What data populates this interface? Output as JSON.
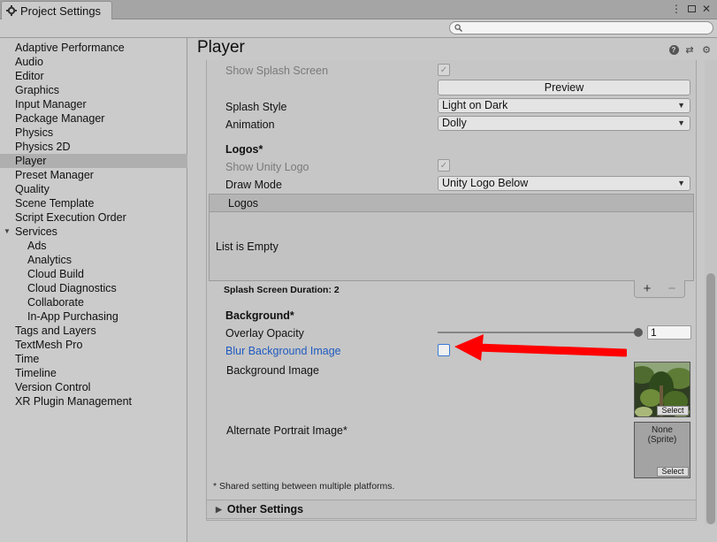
{
  "window": {
    "tab_title": "Project Settings",
    "colors": {
      "accent_blue": "#1f5bc0",
      "arrow_red": "#ff0000",
      "selected_row": "#afafaf"
    }
  },
  "search": {
    "placeholder": ""
  },
  "sidebar": {
    "items": [
      {
        "label": "Adaptive Performance",
        "indent": 0
      },
      {
        "label": "Audio",
        "indent": 0
      },
      {
        "label": "Editor",
        "indent": 0
      },
      {
        "label": "Graphics",
        "indent": 0
      },
      {
        "label": "Input Manager",
        "indent": 0
      },
      {
        "label": "Package Manager",
        "indent": 0
      },
      {
        "label": "Physics",
        "indent": 0
      },
      {
        "label": "Physics 2D",
        "indent": 0
      },
      {
        "label": "Player",
        "indent": 0,
        "selected": true
      },
      {
        "label": "Preset Manager",
        "indent": 0
      },
      {
        "label": "Quality",
        "indent": 0
      },
      {
        "label": "Scene Template",
        "indent": 0
      },
      {
        "label": "Script Execution Order",
        "indent": 0
      },
      {
        "label": "Services",
        "indent": 0,
        "expandable": true
      },
      {
        "label": "Ads",
        "indent": 1
      },
      {
        "label": "Analytics",
        "indent": 1
      },
      {
        "label": "Cloud Build",
        "indent": 1
      },
      {
        "label": "Cloud Diagnostics",
        "indent": 1
      },
      {
        "label": "Collaborate",
        "indent": 1
      },
      {
        "label": "In-App Purchasing",
        "indent": 1
      },
      {
        "label": "Tags and Layers",
        "indent": 0
      },
      {
        "label": "TextMesh Pro",
        "indent": 0
      },
      {
        "label": "Time",
        "indent": 0
      },
      {
        "label": "Timeline",
        "indent": 0
      },
      {
        "label": "Version Control",
        "indent": 0
      },
      {
        "label": "XR Plugin Management",
        "indent": 0
      }
    ]
  },
  "main": {
    "title": "Player",
    "splash": {
      "show_splash_label": "Show Splash Screen",
      "show_splash_checked": true,
      "preview_label": "Preview",
      "splash_style_label": "Splash Style",
      "splash_style_value": "Light on Dark",
      "animation_label": "Animation",
      "animation_value": "Dolly"
    },
    "logos": {
      "header": "Logos*",
      "show_unity_logo_label": "Show Unity Logo",
      "show_unity_logo_checked": true,
      "draw_mode_label": "Draw Mode",
      "draw_mode_value": "Unity Logo Below",
      "list_header": "Logos",
      "list_empty": "List is Empty",
      "plus": "+",
      "minus": "−"
    },
    "duration_label": "Splash Screen Duration: 2",
    "background": {
      "header": "Background*",
      "overlay_opacity_label": "Overlay Opacity",
      "overlay_opacity_value": "1",
      "blur_label": "Blur Background Image",
      "blur_checked": false,
      "bg_image_label": "Background Image",
      "bg_select": "Select",
      "alt_portrait_label": "Alternate Portrait Image*",
      "alt_none": "None\n(Sprite)",
      "alt_select": "Select"
    },
    "footnote": "* Shared setting between multiple platforms.",
    "other_settings": "Other Settings"
  }
}
